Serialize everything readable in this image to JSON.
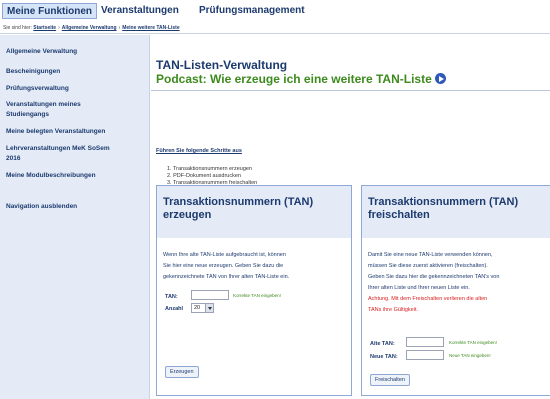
{
  "topnav": {
    "tabs": [
      {
        "label": "Meine Funktionen",
        "active": true
      },
      {
        "label": "Veranstaltungen",
        "active": false
      },
      {
        "label": "Prüfungsmanagement",
        "active": false
      }
    ]
  },
  "breadcrumb": {
    "prefix": "Sie sind hier:",
    "items": [
      "Startseite",
      "Allgemeine Verwaltung",
      "Meine weitere TAN-Liste"
    ]
  },
  "sidebar": {
    "items": [
      "Allgemeine Verwaltung",
      "Bescheinigungen",
      "Prüfungsverwaltung",
      "Veranstaltungen meines",
      "Studiengangs",
      "Meine belegten Veranstaltungen",
      "Lehrveranstaltungen MeK SoSem",
      "2016",
      "Meine Modulbeschreibungen",
      "Navigation ausblenden"
    ]
  },
  "main": {
    "title": "TAN-Listen-Verwaltung",
    "podcast": "Podcast: Wie erzeuge ich eine weitere TAN-Liste",
    "steps_heading": "Führen Sie folgende Schritte aus",
    "steps": [
      "1. Transaktionsnummern erzeugen",
      "2. PDF-Dokument ausdrucken",
      "3. Transaktionsnummern freischalten"
    ]
  },
  "box_left": {
    "title_line1": "Transaktionsnummern (TAN)",
    "title_line2": "erzeugen",
    "text": [
      "Wenn Ihre alte TAN-Liste aufgebraucht ist, können",
      "Sie hier eine neue erzeugen. Geben Sie dazu die",
      "gekennzeichnete TAN von Ihrer alten TAN-Liste ein."
    ],
    "tan_label": "TAN:",
    "tan_value": "",
    "tan_note": "Korrekte TAN eingeben!",
    "count_label": "Anzahl",
    "count_value": "20",
    "button": "Erzeugen"
  },
  "box_right": {
    "title_line1": "Transaktionsnummern (TAN)",
    "title_line2": "freischalten",
    "text": [
      "Damit Sie eine neue TAN-Liste verwenden können,",
      "müssen Sie diese zuerst aktivieren (freischalten).",
      "Geben Sie dazu hier die gekennzeichneten TAN's von",
      "Ihrer alten Liste und Ihrer neuen Liste ein."
    ],
    "warning": [
      "Achtung. Mit dem Freischalten verlieren die alten",
      "TANs ihre Gültigkeit."
    ],
    "old_label": "Alte TAN:",
    "old_value": "",
    "old_note": "Korrekte TAN eingeben!",
    "new_label": "Neue TAN:",
    "new_value": "",
    "new_note": "Neue TAN eingeben!",
    "button": "Freischalten"
  }
}
